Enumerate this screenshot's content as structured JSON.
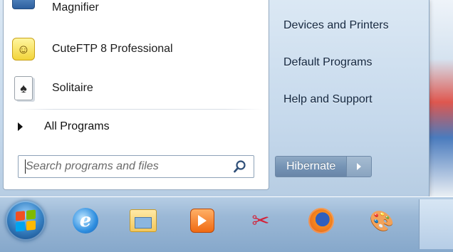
{
  "start_menu": {
    "programs": [
      {
        "label": "Magnifier",
        "icon": "magnifier-icon"
      },
      {
        "label": "CuteFTP 8 Professional",
        "icon": "cuteftp-icon"
      },
      {
        "label": "Solitaire",
        "icon": "solitaire-icon"
      }
    ],
    "all_programs_label": "All Programs",
    "search_placeholder": "Search programs and files",
    "right_links": [
      "Devices and Printers",
      "Default Programs",
      "Help and Support"
    ],
    "power_button_label": "Hibernate"
  },
  "taskbar": {
    "pinned": [
      "internet-explorer-icon",
      "windows-explorer-icon",
      "media-player-icon",
      "snipping-tool-icon",
      "firefox-icon",
      "paint-icon"
    ]
  },
  "colors": {
    "accent": "#3a86c8",
    "taskbar": "#9bb8d6",
    "menu_right_pane": "#c6d9ec"
  }
}
